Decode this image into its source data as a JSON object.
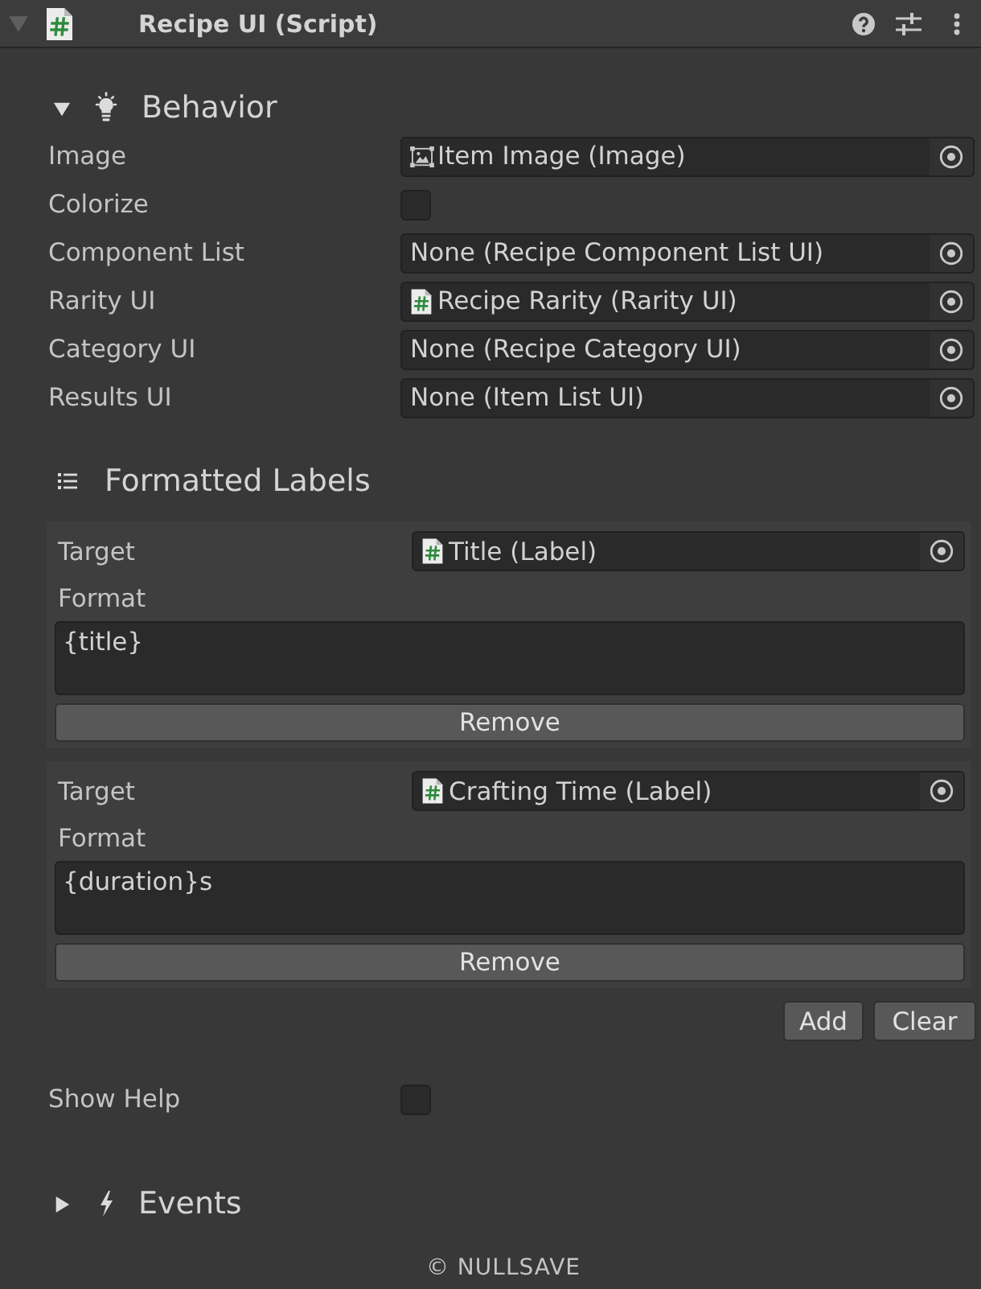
{
  "component": {
    "title": "Recipe UI (Script)",
    "expanded": true
  },
  "behavior": {
    "title": "Behavior",
    "expanded": true,
    "fields": [
      {
        "label": "Image",
        "kind": "image",
        "value": "Item Image (Image)"
      },
      {
        "label": "Colorize",
        "kind": "toggle",
        "checked": false
      },
      {
        "label": "Component List",
        "kind": "empty",
        "value": "None (Recipe Component List UI)"
      },
      {
        "label": "Rarity UI",
        "kind": "script",
        "value": "Recipe Rarity (Rarity UI)"
      },
      {
        "label": "Category UI",
        "kind": "empty",
        "value": "None (Recipe Category UI)"
      },
      {
        "label": "Results UI",
        "kind": "empty",
        "value": "None (Item List UI)"
      }
    ]
  },
  "formatted_labels": {
    "title": "Formatted Labels",
    "entries": [
      {
        "target_label": "Target",
        "target": "Title (Label)",
        "format_label": "Format",
        "format": "{title}",
        "remove": "Remove"
      },
      {
        "target_label": "Target",
        "target": "Crafting Time (Label)",
        "format_label": "Format",
        "format": "{duration}s",
        "remove": "Remove"
      }
    ],
    "buttons": [
      "Add",
      "Clear"
    ]
  },
  "show_help": {
    "label": "Show Help",
    "checked": false
  },
  "events": {
    "title": "Events",
    "expanded": false
  },
  "footer": "© NULLSAVE"
}
